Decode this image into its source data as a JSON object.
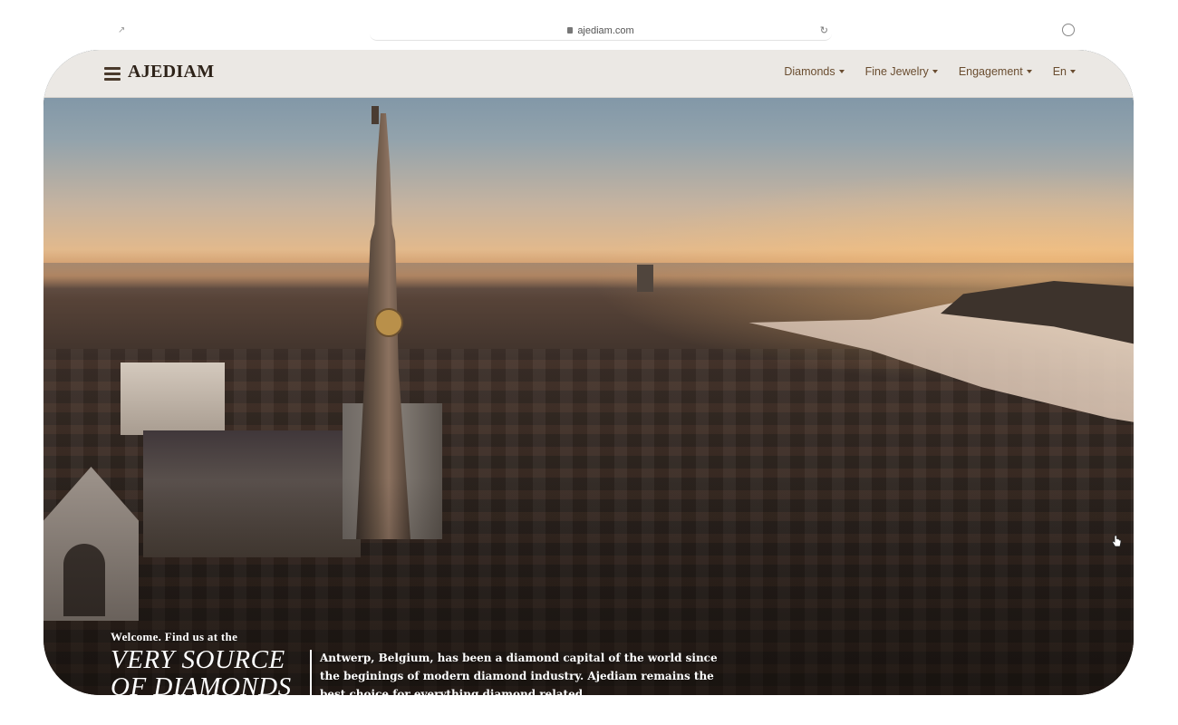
{
  "browser": {
    "url": "ajediam.com"
  },
  "navbar": {
    "brand": "AJEDIAM",
    "items": [
      {
        "label": "Diamonds"
      },
      {
        "label": "Fine Jewelry"
      },
      {
        "label": "Engagement"
      },
      {
        "label": "En"
      }
    ]
  },
  "hero": {
    "welcome": "Welcome. Find us at the",
    "headline": "VERY SOURCE OF DIAMONDS",
    "blurb": "Antwerp, Belgium, has been a diamond capital of the world since the beginings of modern diamond industry. Ajediam remains the best choice for everything diamond related."
  },
  "icons": [
    "lock-icon",
    "menu-icon",
    "caret-icon",
    "cursor-icon"
  ],
  "colors": {
    "navbar_bg": "#ebe8e4",
    "brand_text": "#2d2218",
    "nav_text": "#6a4d30",
    "hero_text": "#ffffff"
  }
}
